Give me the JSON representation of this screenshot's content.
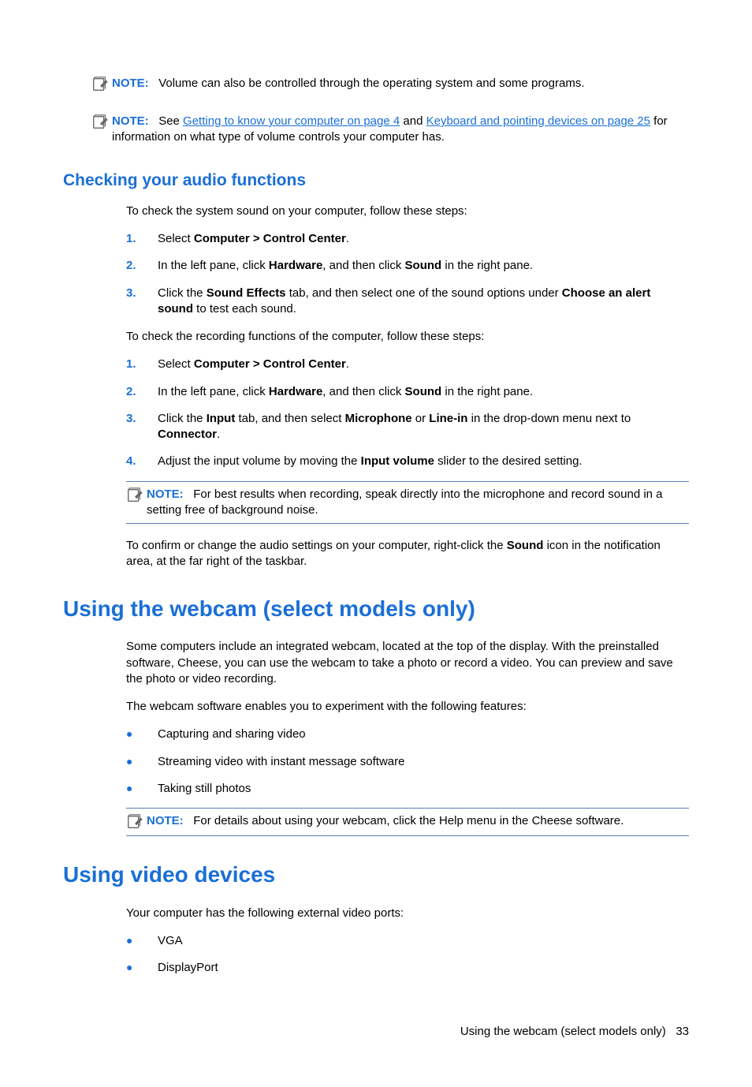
{
  "notes": {
    "n1": {
      "label": "NOTE:",
      "text": "Volume can also be controlled through the operating system and some programs."
    },
    "n2": {
      "label": "NOTE:",
      "pre": "See ",
      "link1": "Getting to know your computer on page 4",
      "mid": " and ",
      "link2": "Keyboard and pointing devices on page 25",
      "post": " for information on what type of volume controls your computer has."
    },
    "n3": {
      "label": "NOTE:",
      "text": "For best results when recording, speak directly into the microphone and record sound in a setting free of background noise."
    },
    "n4": {
      "label": "NOTE:",
      "text": "For details about using your webcam, click the Help menu in the Cheese software."
    }
  },
  "headings": {
    "h_check": "Checking your audio functions",
    "h_webcam": "Using the webcam (select models only)",
    "h_video": "Using video devices"
  },
  "para": {
    "p1": "To check the system sound on your computer, follow these steps:",
    "p2": "To check the recording functions of the computer, follow these steps:",
    "p_webcam1": "Some computers include an integrated webcam, located at the top of the display. With the preinstalled software, Cheese, you can use the webcam to take a photo or record a video. You can preview and save the photo or video recording.",
    "p_webcam2": "The webcam software enables you to experiment with the following features:",
    "p_video1": "Your computer has the following external video ports:"
  },
  "list1": {
    "i1_num": "1.",
    "i1_a": "Select ",
    "i1_b": "Computer > Control Center",
    "i1_c": ".",
    "i2_num": "2.",
    "i2_a": "In the left pane, click ",
    "i2_b": "Hardware",
    "i2_c": ", and then click ",
    "i2_d": "Sound",
    "i2_e": " in the right pane.",
    "i3_num": "3.",
    "i3_a": "Click the ",
    "i3_b": "Sound Effects",
    "i3_c": " tab, and then select one of the sound options under ",
    "i3_d": "Choose an alert sound",
    "i3_e": " to test each sound."
  },
  "list2": {
    "i1_num": "1.",
    "i1_a": "Select ",
    "i1_b": "Computer > Control Center",
    "i1_c": ".",
    "i2_num": "2.",
    "i2_a": "In the left pane, click ",
    "i2_b": "Hardware",
    "i2_c": ", and then click ",
    "i2_d": "Sound",
    "i2_e": " in the right pane.",
    "i3_num": "3.",
    "i3_a": "Click the ",
    "i3_b": "Input",
    "i3_c": " tab, and then select ",
    "i3_d": "Microphone",
    "i3_e": " or ",
    "i3_f": "Line-in",
    "i3_g": " in the drop-down menu next to ",
    "i3_h": "Connector",
    "i3_i": ".",
    "i4_num": "4.",
    "i4_a": "Adjust the input volume by moving the ",
    "i4_b": "Input volume",
    "i4_c": " slider to the desired setting."
  },
  "confirm": {
    "a": "To confirm or change the audio settings on your computer, right-click the ",
    "b": "Sound",
    "c": " icon in the notification area, at the far right of the taskbar."
  },
  "bullets_webcam": {
    "b1": "Capturing and sharing video",
    "b2": "Streaming video with instant message software",
    "b3": "Taking still photos"
  },
  "bullets_video": {
    "b1": "VGA",
    "b2": "DisplayPort"
  },
  "footer": {
    "text": "Using the webcam (select models only)",
    "page": "33"
  }
}
